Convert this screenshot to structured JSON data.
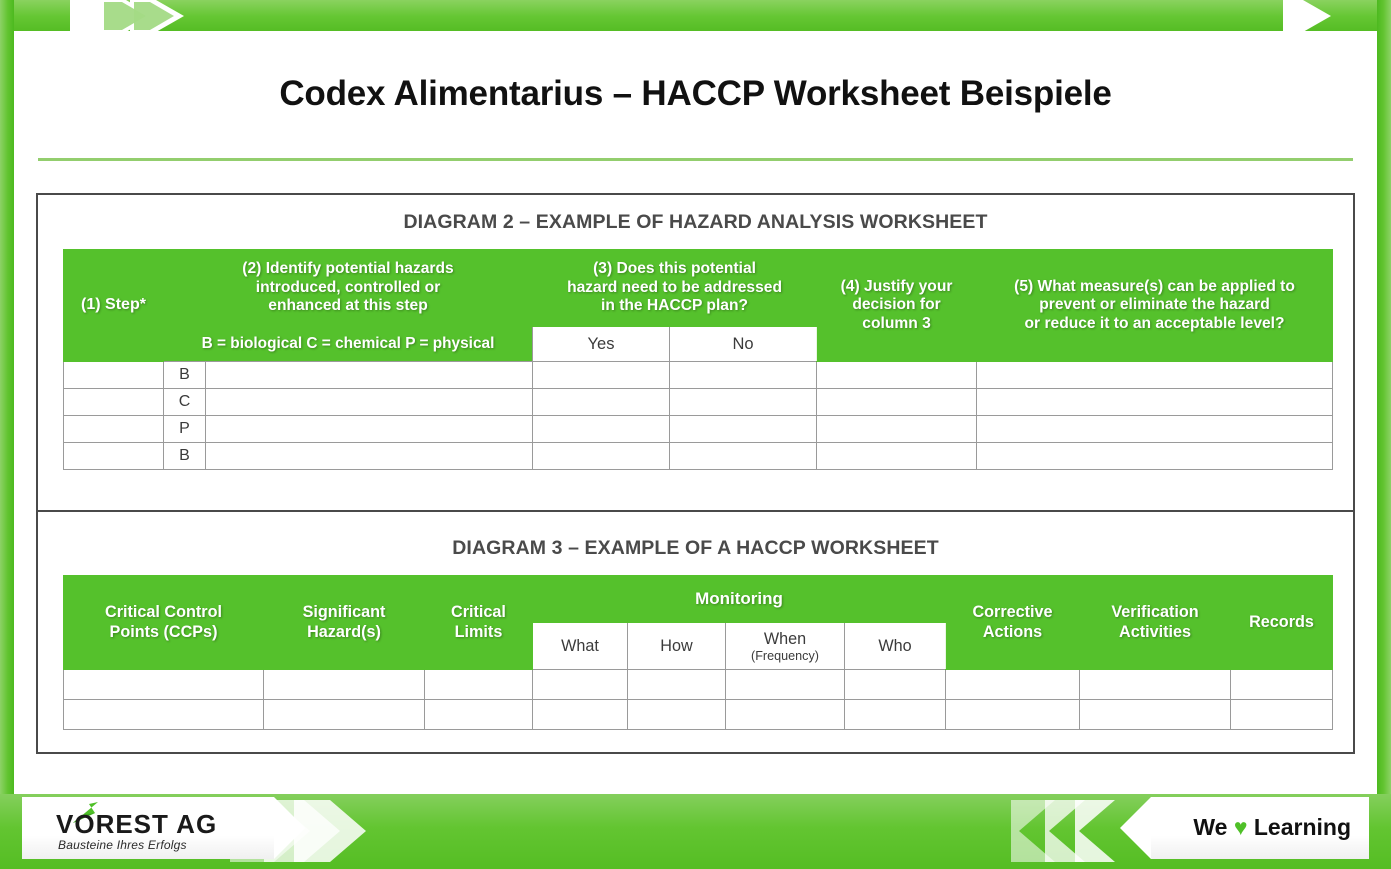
{
  "slide": {
    "title": "Codex Alimentarius – HACCP Worksheet Beispiele",
    "accent_green": "#55c12c",
    "frame_green": "#62c430",
    "rule_green": "#93ce6e",
    "border_gray": "#4a4a4a"
  },
  "diagram2": {
    "title": "DIAGRAM 2 – EXAMPLE OF HAZARD ANALYSIS WORKSHEET",
    "headers": {
      "step": "(1) Step*",
      "identify": "(2) Identify potential hazards\nintroduced, controlled or\nenhanced at this step",
      "identify_line1": "(2) Identify potential hazards",
      "identify_line2": "introduced, controlled or",
      "identify_line3": "enhanced at this step",
      "legend": "B = biological  C = chemical  P = physical",
      "address_line1": "(3) Does this potential",
      "address_line2": "hazard need to be addressed",
      "address_line3": "in the HACCP plan?",
      "yes": "Yes",
      "no": "No",
      "justify_line1": "(4) Justify your",
      "justify_line2": "decision for",
      "justify_line3": "column 3",
      "measures_line1": "(5) What measure(s) can be applied to",
      "measures_line2": "prevent or eliminate the hazard",
      "measures_line3": "or reduce it to an acceptable level?"
    },
    "rows": [
      {
        "step": "",
        "letter": "B",
        "hazards": "",
        "yes": "",
        "no": "",
        "justify": "",
        "measures": ""
      },
      {
        "step": "",
        "letter": "C",
        "hazards": "",
        "yes": "",
        "no": "",
        "justify": "",
        "measures": ""
      },
      {
        "step": "",
        "letter": "P",
        "hazards": "",
        "yes": "",
        "no": "",
        "justify": "",
        "measures": ""
      },
      {
        "step": "",
        "letter": "B",
        "hazards": "",
        "yes": "",
        "no": "",
        "justify": "",
        "measures": ""
      }
    ]
  },
  "diagram3": {
    "title": "DIAGRAM 3 – EXAMPLE OF A HACCP WORKSHEET",
    "headers": {
      "ccp_line1": "Critical Control",
      "ccp_line2": "Points (CCPs)",
      "hazard_line1": "Significant",
      "hazard_line2": "Hazard(s)",
      "limits_line1": "Critical",
      "limits_line2": "Limits",
      "monitoring": "Monitoring",
      "what": "What",
      "how": "How",
      "when": "When",
      "when_sub": "(Frequency)",
      "who": "Who",
      "corrective_line1": "Corrective",
      "corrective_line2": "Actions",
      "verification_line1": "Verification",
      "verification_line2": "Activities",
      "records": "Records"
    },
    "rows": [
      {
        "ccp": "",
        "hazard": "",
        "limits": "",
        "what": "",
        "how": "",
        "when": "",
        "who": "",
        "corrective": "",
        "verification": "",
        "records": ""
      },
      {
        "ccp": "",
        "hazard": "",
        "limits": "",
        "what": "",
        "how": "",
        "when": "",
        "who": "",
        "corrective": "",
        "verification": "",
        "records": ""
      }
    ]
  },
  "footer": {
    "company": "VOREST AG",
    "tagline": "Bausteine Ihres Erfolgs",
    "slogan_pre": "We",
    "slogan_heart": "♥",
    "slogan_post": "Learning"
  }
}
